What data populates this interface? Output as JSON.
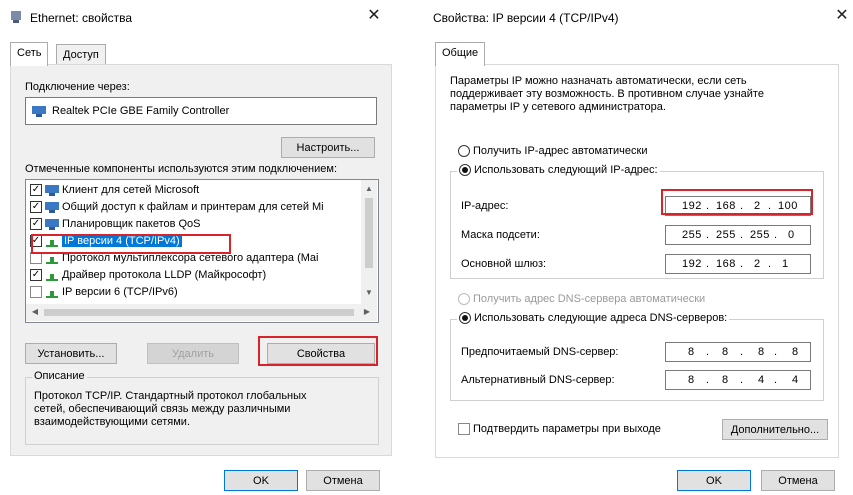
{
  "left_dialog": {
    "title": "Ethernet: свойства",
    "close_glyph": "✕",
    "tabs": [
      {
        "label": "Сеть"
      },
      {
        "label": "Доступ"
      }
    ],
    "connect_label": "Подключение через:",
    "adapter_name": "Realtek PCIe GBE Family Controller",
    "configure_button": "Настроить...",
    "components_label": "Отмеченные компоненты используются этим подключением:",
    "components": [
      {
        "label": "Клиент для сетей Microsoft",
        "checked": true
      },
      {
        "label": "Общий доступ к файлам и принтерам для сетей Mi",
        "checked": true
      },
      {
        "label": "Планировщик пакетов QoS",
        "checked": true
      },
      {
        "label": "IP версии 4 (TCP/IPv4)",
        "checked": true,
        "selected": true
      },
      {
        "label": "Протокол мультиплексора сетевого адаптера (Mai",
        "checked": false
      },
      {
        "label": "Драйвер протокола LLDP (Майкрософт)",
        "checked": true
      },
      {
        "label": "IP версии 6 (TCP/IPv6)",
        "checked": false
      }
    ],
    "install_button": "Установить...",
    "remove_button": "Удалить",
    "properties_button": "Свойства",
    "description_label": "Описание",
    "description_text": "Протокол TCP/IP. Стандартный протокол глобальных сетей, обеспечивающий связь между различными взаимодействующими сетями.",
    "ok_button": "OK",
    "cancel_button": "Отмена",
    "highlight_color": "#d9232a",
    "selection_color": "#0078d7"
  },
  "right_dialog": {
    "title": "Свойства: IP версии 4 (TCP/IPv4)",
    "close_glyph": "✕",
    "tabs": [
      {
        "label": "Общие"
      }
    ],
    "intro_text": "Параметры IP можно назначать автоматически, если сеть поддерживает эту возможность. В противном случае узнайте параметры IP у сетевого администратора.",
    "radio_auto_ip": "Получить IP-адрес автоматически",
    "radio_manual_ip": "Использовать следующий IP-адрес:",
    "ip_label": "IP-адрес:",
    "ip_address": [
      "192",
      "168",
      "2",
      "100"
    ],
    "mask_label": "Маска подсети:",
    "subnet_mask": [
      "255",
      "255",
      "255",
      "0"
    ],
    "gateway_label": "Основной шлюз:",
    "gateway": [
      "192",
      "168",
      "2",
      "1"
    ],
    "radio_auto_dns": "Получить адрес DNS-сервера автоматически",
    "radio_manual_dns": "Использовать следующие адреса DNS-серверов:",
    "preferred_dns_label": "Предпочитаемый DNS-сервер:",
    "preferred_dns": [
      "8",
      "8",
      "8",
      "8"
    ],
    "alternate_dns_label": "Альтернативный DNS-сервер:",
    "alternate_dns": [
      "8",
      "8",
      "4",
      "4"
    ],
    "validate_checkbox": "Подтвердить параметры при выходе",
    "advanced_button": "Дополнительно...",
    "ok_button": "OK",
    "cancel_button": "Отмена"
  }
}
